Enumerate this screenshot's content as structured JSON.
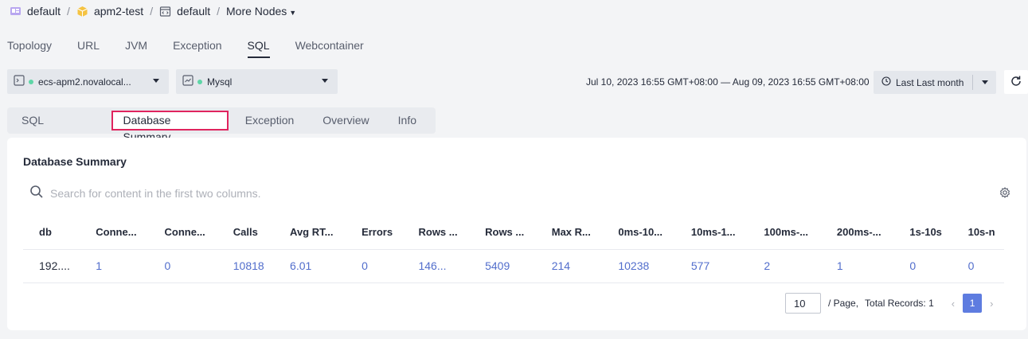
{
  "breadcrumb": {
    "items": [
      "default",
      "apm2-test",
      "default"
    ],
    "more": "More Nodes"
  },
  "top_tabs": [
    "Topology",
    "URL",
    "JVM",
    "Exception",
    "SQL",
    "Webcontainer"
  ],
  "active_top_tab": "SQL",
  "instance_select": "ecs-apm2.novalocal...",
  "db_select": "Mysql",
  "time_range_text": "Jul 10, 2023 16:55 GMT+08:00 — Aug 09, 2023 16:55 GMT+08:00",
  "time_picker_label": "Last Last month",
  "sub_tabs": [
    "SQL Summary",
    "Database Summary",
    "Exception",
    "Overview",
    "Info"
  ],
  "active_sub_tab": "Database Summary",
  "card": {
    "title": "Database Summary",
    "search_placeholder": "Search for content in the first two columns."
  },
  "table": {
    "headers": [
      "db",
      "Conne...",
      "Conne...",
      "Calls",
      "Avg RT...",
      "Errors",
      "Rows ...",
      "Rows ...",
      "Max R...",
      "0ms-10...",
      "10ms-1...",
      "100ms-...",
      "200ms-...",
      "1s-10s",
      "10s-n"
    ],
    "rows": [
      [
        "192....",
        "1",
        "0",
        "10818",
        "6.01",
        "0",
        "146...",
        "5409",
        "214",
        "10238",
        "577",
        "2",
        "1",
        "0",
        "0"
      ]
    ]
  },
  "pagination": {
    "page_size": "10",
    "per_page_label": "/ Page,",
    "total_label": "Total Records: 1",
    "current_page": "1"
  },
  "colors": {
    "accent_link": "#526ecc",
    "active_page": "#5e7ce0",
    "highlight_border": "#e0245e",
    "status_dot": "#5ed6a7"
  }
}
